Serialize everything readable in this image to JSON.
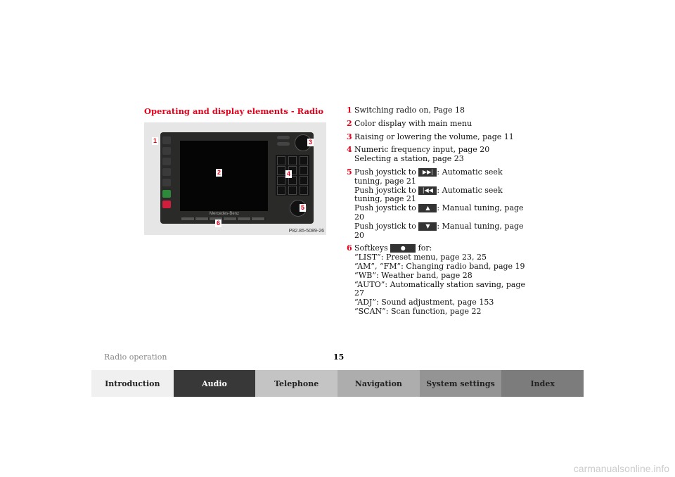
{
  "figure": {
    "title": "Operating and display elements - Radio",
    "caption": "P82.85-5089-26",
    "brand": "Mercedes-Benz",
    "callouts": [
      "1",
      "2",
      "3",
      "4",
      "5",
      "6"
    ]
  },
  "items": [
    {
      "num": "1",
      "lines": [
        "Switching radio on, Page 18"
      ]
    },
    {
      "num": "2",
      "lines": [
        "Color display with main menu"
      ]
    },
    {
      "num": "3",
      "lines": [
        "Raising or lowering the volume, page 11"
      ]
    },
    {
      "num": "4",
      "lines": [
        "Numeric frequency input, page 20",
        "Selecting a station, page 23"
      ]
    },
    {
      "num": "5",
      "joystick": [
        {
          "pre": "Push joystick to",
          "icon": "seek-forward-icon",
          "glyph": "▶▶|",
          "text": ": Automatic seek tuning, page 21"
        },
        {
          "pre": "Push joystick to",
          "icon": "seek-back-icon",
          "glyph": "|◀◀",
          "text": ": Automatic seek tuning, page 21"
        },
        {
          "pre": "Push joystick to",
          "icon": "arrow-up-icon",
          "glyph": "▲",
          "text": ": Manual tuning, page 20"
        },
        {
          "pre": "Push joystick to",
          "icon": "arrow-down-icon",
          "glyph": "▼",
          "text": ": Manual tuning, page 20"
        }
      ]
    },
    {
      "num": "6",
      "softkeys": {
        "pre": "Softkeys",
        "glyph": "●",
        "post": " for:",
        "lines": [
          "“LIST”: Preset menu, page 23, 25",
          "“AM”, “FM”: Changing radio band, page 19",
          "“WB”: Weather band, page 28",
          "“AUTO”: Automatically station saving, page 27",
          "“ADJ”: Sound adjustment, page 153",
          "“SCAN”: Scan function, page 22"
        ]
      }
    }
  ],
  "footer": {
    "section": "Radio operation",
    "page": "15"
  },
  "tabs": [
    {
      "label": "Introduction",
      "bg": "#f0f0f0",
      "fg": "#222"
    },
    {
      "label": "Audio",
      "bg": "#383838",
      "fg": "#fff"
    },
    {
      "label": "Telephone",
      "bg": "#c4c4c4",
      "fg": "#222"
    },
    {
      "label": "Navigation",
      "bg": "#adadad",
      "fg": "#222"
    },
    {
      "label": "System settings",
      "bg": "#949494",
      "fg": "#222"
    },
    {
      "label": "Index",
      "bg": "#7c7c7c",
      "fg": "#222"
    }
  ],
  "watermark": "carmanualsonline.info"
}
